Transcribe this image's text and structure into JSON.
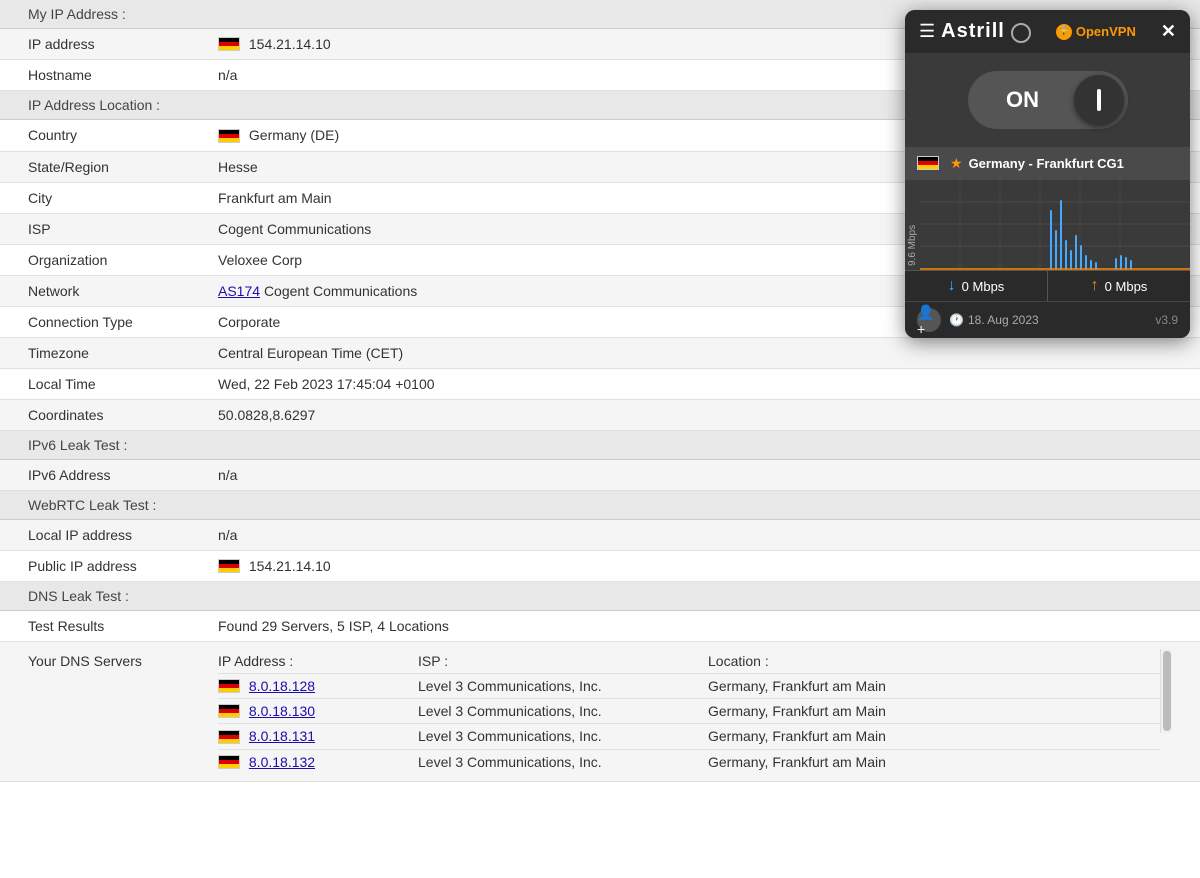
{
  "myIp": {
    "sectionTitle": "My IP Address :",
    "rows": [
      {
        "label": "IP address",
        "value": "154.21.14.10",
        "hasFlag": true
      },
      {
        "label": "Hostname",
        "value": "n/a",
        "hasFlag": false
      }
    ]
  },
  "ipLocation": {
    "sectionTitle": "IP Address Location :",
    "rows": [
      {
        "label": "Country",
        "value": "Germany (DE)",
        "hasFlag": true
      },
      {
        "label": "State/Region",
        "value": "Hesse",
        "hasFlag": false
      },
      {
        "label": "City",
        "value": "Frankfurt am Main",
        "hasFlag": false
      },
      {
        "label": "ISP",
        "value": "Cogent Communications",
        "hasFlag": false
      },
      {
        "label": "Organization",
        "value": "Veloxee Corp",
        "hasFlag": false
      },
      {
        "label": "Network",
        "value": "AS174 Cogent Communications",
        "hasFlag": false,
        "hasLink": true,
        "linkText": "AS174",
        "afterLink": " Cogent Communications"
      },
      {
        "label": "Connection Type",
        "value": "Corporate",
        "hasFlag": false
      },
      {
        "label": "Timezone",
        "value": "Central European Time (CET)",
        "hasFlag": false
      },
      {
        "label": "Local Time",
        "value": "Wed, 22 Feb 2023 17:45:04 +0100",
        "hasFlag": false
      },
      {
        "label": "Coordinates",
        "value": "50.0828,8.6297",
        "hasFlag": false
      }
    ]
  },
  "ipv6": {
    "sectionTitle": "IPv6 Leak Test :",
    "rows": [
      {
        "label": "IPv6 Address",
        "value": "n/a",
        "hasFlag": false
      }
    ]
  },
  "webrtc": {
    "sectionTitle": "WebRTC Leak Test :",
    "rows": [
      {
        "label": "Local IP address",
        "value": "n/a",
        "hasFlag": false
      },
      {
        "label": "Public IP address",
        "value": "154.21.14.10",
        "hasFlag": true
      }
    ]
  },
  "dns": {
    "sectionTitle": "DNS Leak Test :",
    "testResults": {
      "label": "Test Results",
      "value": "Found 29 Servers, 5 ISP, 4 Locations"
    },
    "dnsServers": {
      "label": "Your DNS Servers",
      "headers": {
        "ip": "IP Address :",
        "isp": "ISP :",
        "location": "Location :"
      },
      "rows": [
        {
          "ip": "8.0.18.128",
          "isp": "Level 3 Communications, Inc.",
          "location": "Germany, Frankfurt am Main",
          "hasFlag": true
        },
        {
          "ip": "8.0.18.130",
          "isp": "Level 3 Communications, Inc.",
          "location": "Germany, Frankfurt am Main",
          "hasFlag": true
        },
        {
          "ip": "8.0.18.131",
          "isp": "Level 3 Communications, Inc.",
          "location": "Germany, Frankfurt am Main",
          "hasFlag": true
        },
        {
          "ip": "8.0.18.132",
          "isp": "Level 3 Communications, Inc.",
          "location": "Germany, Frankfurt am Main",
          "hasFlag": true
        }
      ]
    }
  },
  "vpn": {
    "title": "Astrill",
    "protocol": "OpenVPN",
    "closeLabel": "✕",
    "toggleState": "ON",
    "server": "Germany - Frankfurt CG1",
    "chartLabel": "9.6 Mbps",
    "speedDown": "0 Mbps",
    "speedUp": "0 Mbps",
    "date": "18. Aug 2023",
    "version": "v3.9"
  }
}
